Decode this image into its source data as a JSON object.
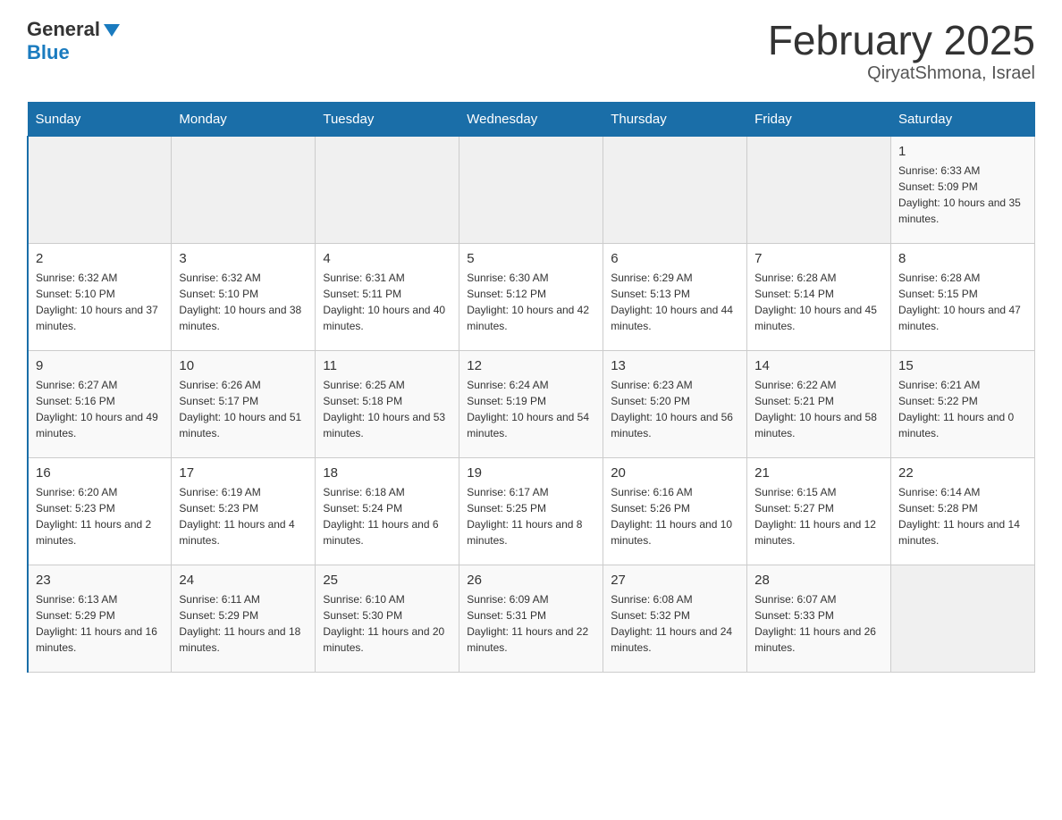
{
  "header": {
    "logo_general": "General",
    "logo_blue": "Blue",
    "title": "February 2025",
    "subtitle": "QiryatShmona, Israel"
  },
  "days_of_week": [
    "Sunday",
    "Monday",
    "Tuesday",
    "Wednesday",
    "Thursday",
    "Friday",
    "Saturday"
  ],
  "weeks": [
    {
      "days": [
        {
          "num": "",
          "info": ""
        },
        {
          "num": "",
          "info": ""
        },
        {
          "num": "",
          "info": ""
        },
        {
          "num": "",
          "info": ""
        },
        {
          "num": "",
          "info": ""
        },
        {
          "num": "",
          "info": ""
        },
        {
          "num": "1",
          "info": "Sunrise: 6:33 AM\nSunset: 5:09 PM\nDaylight: 10 hours and 35 minutes."
        }
      ]
    },
    {
      "days": [
        {
          "num": "2",
          "info": "Sunrise: 6:32 AM\nSunset: 5:10 PM\nDaylight: 10 hours and 37 minutes."
        },
        {
          "num": "3",
          "info": "Sunrise: 6:32 AM\nSunset: 5:10 PM\nDaylight: 10 hours and 38 minutes."
        },
        {
          "num": "4",
          "info": "Sunrise: 6:31 AM\nSunset: 5:11 PM\nDaylight: 10 hours and 40 minutes."
        },
        {
          "num": "5",
          "info": "Sunrise: 6:30 AM\nSunset: 5:12 PM\nDaylight: 10 hours and 42 minutes."
        },
        {
          "num": "6",
          "info": "Sunrise: 6:29 AM\nSunset: 5:13 PM\nDaylight: 10 hours and 44 minutes."
        },
        {
          "num": "7",
          "info": "Sunrise: 6:28 AM\nSunset: 5:14 PM\nDaylight: 10 hours and 45 minutes."
        },
        {
          "num": "8",
          "info": "Sunrise: 6:28 AM\nSunset: 5:15 PM\nDaylight: 10 hours and 47 minutes."
        }
      ]
    },
    {
      "days": [
        {
          "num": "9",
          "info": "Sunrise: 6:27 AM\nSunset: 5:16 PM\nDaylight: 10 hours and 49 minutes."
        },
        {
          "num": "10",
          "info": "Sunrise: 6:26 AM\nSunset: 5:17 PM\nDaylight: 10 hours and 51 minutes."
        },
        {
          "num": "11",
          "info": "Sunrise: 6:25 AM\nSunset: 5:18 PM\nDaylight: 10 hours and 53 minutes."
        },
        {
          "num": "12",
          "info": "Sunrise: 6:24 AM\nSunset: 5:19 PM\nDaylight: 10 hours and 54 minutes."
        },
        {
          "num": "13",
          "info": "Sunrise: 6:23 AM\nSunset: 5:20 PM\nDaylight: 10 hours and 56 minutes."
        },
        {
          "num": "14",
          "info": "Sunrise: 6:22 AM\nSunset: 5:21 PM\nDaylight: 10 hours and 58 minutes."
        },
        {
          "num": "15",
          "info": "Sunrise: 6:21 AM\nSunset: 5:22 PM\nDaylight: 11 hours and 0 minutes."
        }
      ]
    },
    {
      "days": [
        {
          "num": "16",
          "info": "Sunrise: 6:20 AM\nSunset: 5:23 PM\nDaylight: 11 hours and 2 minutes."
        },
        {
          "num": "17",
          "info": "Sunrise: 6:19 AM\nSunset: 5:23 PM\nDaylight: 11 hours and 4 minutes."
        },
        {
          "num": "18",
          "info": "Sunrise: 6:18 AM\nSunset: 5:24 PM\nDaylight: 11 hours and 6 minutes."
        },
        {
          "num": "19",
          "info": "Sunrise: 6:17 AM\nSunset: 5:25 PM\nDaylight: 11 hours and 8 minutes."
        },
        {
          "num": "20",
          "info": "Sunrise: 6:16 AM\nSunset: 5:26 PM\nDaylight: 11 hours and 10 minutes."
        },
        {
          "num": "21",
          "info": "Sunrise: 6:15 AM\nSunset: 5:27 PM\nDaylight: 11 hours and 12 minutes."
        },
        {
          "num": "22",
          "info": "Sunrise: 6:14 AM\nSunset: 5:28 PM\nDaylight: 11 hours and 14 minutes."
        }
      ]
    },
    {
      "days": [
        {
          "num": "23",
          "info": "Sunrise: 6:13 AM\nSunset: 5:29 PM\nDaylight: 11 hours and 16 minutes."
        },
        {
          "num": "24",
          "info": "Sunrise: 6:11 AM\nSunset: 5:29 PM\nDaylight: 11 hours and 18 minutes."
        },
        {
          "num": "25",
          "info": "Sunrise: 6:10 AM\nSunset: 5:30 PM\nDaylight: 11 hours and 20 minutes."
        },
        {
          "num": "26",
          "info": "Sunrise: 6:09 AM\nSunset: 5:31 PM\nDaylight: 11 hours and 22 minutes."
        },
        {
          "num": "27",
          "info": "Sunrise: 6:08 AM\nSunset: 5:32 PM\nDaylight: 11 hours and 24 minutes."
        },
        {
          "num": "28",
          "info": "Sunrise: 6:07 AM\nSunset: 5:33 PM\nDaylight: 11 hours and 26 minutes."
        },
        {
          "num": "",
          "info": ""
        }
      ]
    }
  ]
}
